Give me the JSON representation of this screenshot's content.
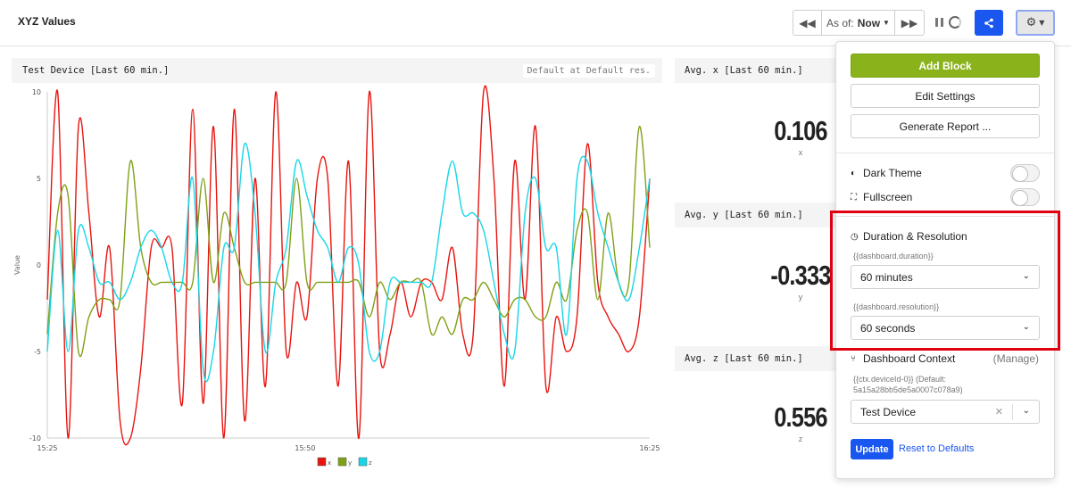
{
  "header": {
    "title": "XYZ Values",
    "as_of_label": "As of:",
    "as_of_value": "Now"
  },
  "chart_panel": {
    "title": "Test Device [Last 60 min.]",
    "badge": "Default at Default res."
  },
  "chart_data": {
    "type": "line",
    "ylabel": "Value",
    "ylim": [
      -10,
      10
    ],
    "yticks": [
      10,
      5,
      0,
      -5,
      -10
    ],
    "xticks": [
      "15:25",
      "15:50",
      "16:25"
    ],
    "legend_position": "bottom-center",
    "series": [
      {
        "name": "x",
        "color": "#e8140f",
        "values": [
          -2,
          10,
          -10,
          8,
          3,
          -3,
          1,
          -9,
          -10,
          -6,
          1,
          1,
          1,
          -8,
          9,
          -8,
          8,
          -10,
          9,
          -9,
          5,
          -7,
          10,
          -5,
          -1,
          -3,
          5,
          5,
          -7,
          6,
          -10,
          10,
          -5,
          -4,
          -1,
          -3,
          -1,
          -1,
          -2,
          1,
          -4,
          -4,
          10,
          5,
          -7,
          6,
          -2,
          8,
          -7,
          -3,
          -5,
          -3,
          7,
          -1,
          -3,
          -4,
          -5,
          -3,
          5
        ]
      },
      {
        "name": "y",
        "color": "#7fa116",
        "values": [
          -4,
          3,
          4,
          -5,
          -3,
          -2,
          -2,
          -2,
          6,
          1,
          -1,
          -1,
          -1,
          -1,
          -1,
          5,
          -1,
          3,
          1,
          -1,
          -1,
          -1,
          -1,
          -1,
          5,
          -1,
          -1,
          -1,
          -1,
          -1,
          -1,
          -3,
          -1,
          -2,
          -1,
          -1,
          -1,
          -4,
          -3,
          -4,
          -2,
          -2,
          -1,
          -2,
          -3,
          -2,
          -2,
          -3,
          -3,
          -1,
          -2,
          2,
          3,
          -2,
          3,
          -1,
          -1,
          8,
          1
        ]
      },
      {
        "name": "z",
        "color": "#17d6e8",
        "values": [
          -5,
          2,
          -5,
          2,
          1,
          -1,
          -1,
          -2,
          -1,
          1,
          2,
          1,
          -1,
          -1,
          5,
          -6,
          -5,
          1,
          1,
          7,
          3,
          -5,
          -1,
          1,
          6,
          4,
          2,
          1,
          -1,
          1,
          0,
          -5,
          -5,
          -1,
          -1,
          -1,
          -1,
          -1,
          3,
          6,
          3,
          3,
          2,
          -1,
          -4,
          -5,
          3,
          5,
          1,
          1,
          -4,
          5,
          6,
          3,
          1,
          -1,
          -2,
          1,
          5
        ]
      }
    ]
  },
  "stats": [
    {
      "title": "Avg. x [Last 60 min.]",
      "value": "0.106",
      "label": "x"
    },
    {
      "title": "Avg. y [Last 60 min.]",
      "value": "-0.333",
      "label": "y"
    },
    {
      "title": "Avg. z [Last 60 min.]",
      "value": "0.556",
      "label": "z"
    }
  ],
  "menu": {
    "add_block": "Add Block",
    "edit_settings": "Edit Settings",
    "generate_report": "Generate Report ...",
    "dark_theme": "Dark Theme",
    "fullscreen": "Fullscreen",
    "duration_section": "Duration & Resolution",
    "duration_hint": "{{dashboard.duration}}",
    "duration_value": "60 minutes",
    "resolution_hint": "{{dashboard.resolution}}",
    "resolution_value": "60 seconds",
    "context_section": "Dashboard Context",
    "manage": "(Manage)",
    "context_hint_1": "{{ctx.deviceId-0}} (Default:",
    "context_hint_2": "5a15a28bb5de5a0007c078a9)",
    "device_value": "Test Device",
    "update": "Update",
    "reset": "Reset to Defaults"
  },
  "colors": {
    "accent_blue": "#1a56f0",
    "add_block_green": "#8ab31b",
    "highlight_red": "#e0000f"
  },
  "icons": [
    "rewind-icon",
    "fast-forward-icon",
    "pause-icon",
    "spinner-icon",
    "share-icon",
    "gear-icon",
    "contrast-icon",
    "fullscreen-icon",
    "clock-icon",
    "nodes-icon",
    "chevron-down-icon",
    "clear-icon"
  ]
}
